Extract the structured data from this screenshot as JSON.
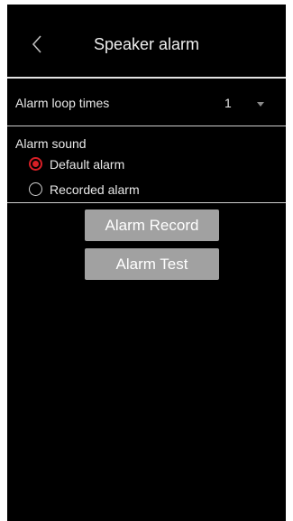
{
  "header": {
    "title": "Speaker alarm",
    "back_icon": "chevron-left-icon"
  },
  "loop": {
    "label": "Alarm loop times",
    "value": "1",
    "dropdown_icon": "caret-down-icon"
  },
  "sound": {
    "title": "Alarm sound",
    "options": [
      {
        "label": "Default alarm",
        "checked": true
      },
      {
        "label": "Recorded alarm",
        "checked": false
      }
    ]
  },
  "buttons": {
    "record": "Alarm Record",
    "test": "Alarm Test"
  },
  "colors": {
    "background": "#000000",
    "accent": "#d81f26",
    "button": "#a1a1a1"
  }
}
